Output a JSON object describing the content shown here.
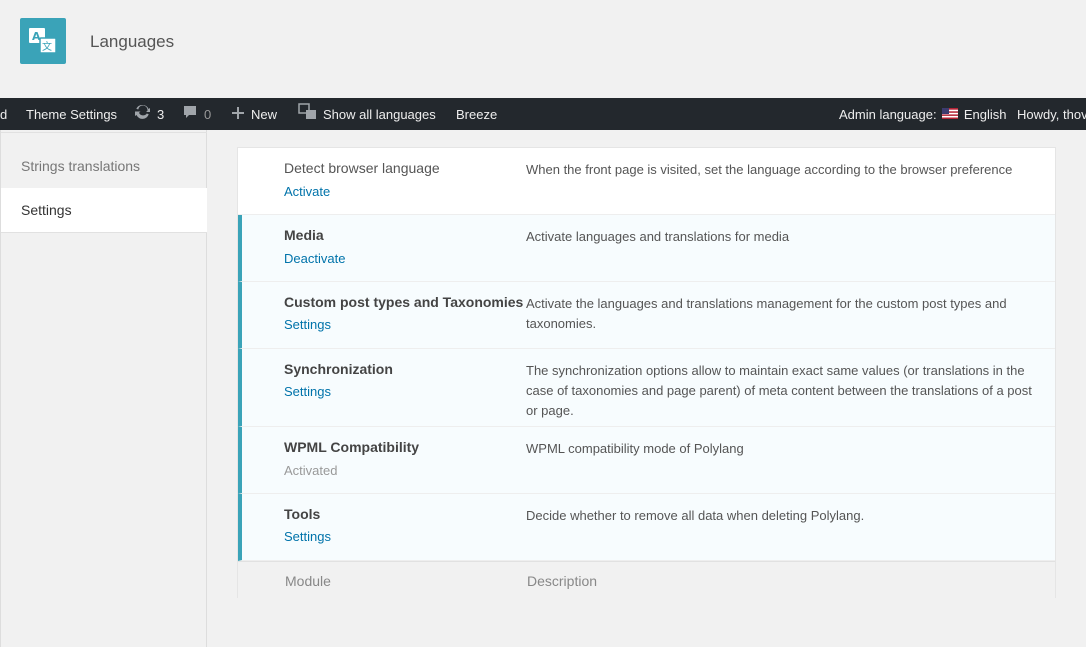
{
  "header": {
    "title": "Languages",
    "icon": "translate-icon",
    "accent_color": "#3aa3b8"
  },
  "adminbar": {
    "cut_item": "d",
    "theme_settings": "Theme Settings",
    "updates_count": "3",
    "comments_count": "0",
    "new_label": "New",
    "show_all_languages": "Show all languages",
    "breeze": "Breeze",
    "admin_language_label": "Admin language:",
    "admin_language_value": "English",
    "howdy": "Howdy, thov"
  },
  "sidebar": {
    "items": [
      {
        "label": "Strings translations"
      },
      {
        "label": "Settings"
      }
    ]
  },
  "modules": [
    {
      "name": "Detect browser language",
      "action": "Activate",
      "description": "When the front page is visited, set the language according to the browser preference",
      "active": false
    },
    {
      "name": "Media",
      "action": "Deactivate",
      "description": "Activate languages and translations for media",
      "active": true
    },
    {
      "name": "Custom post types and Taxonomies",
      "action": "Settings",
      "description": "Activate the languages and translations management for the custom post types and taxonomies.",
      "active": true
    },
    {
      "name": "Synchronization",
      "action": "Settings",
      "description": "The synchronization options allow to maintain exact same values (or translations in the case of taxonomies and page parent) of meta content between the translations of a post or page.",
      "active": true
    },
    {
      "name": "WPML Compatibility",
      "action": "Activated",
      "description": "WPML compatibility mode of Polylang",
      "active": true
    },
    {
      "name": "Tools",
      "action": "Settings",
      "description": "Decide whether to remove all data when deleting Polylang.",
      "active": true
    }
  ],
  "table_footer": {
    "module_header": "Module",
    "description_header": "Description"
  }
}
